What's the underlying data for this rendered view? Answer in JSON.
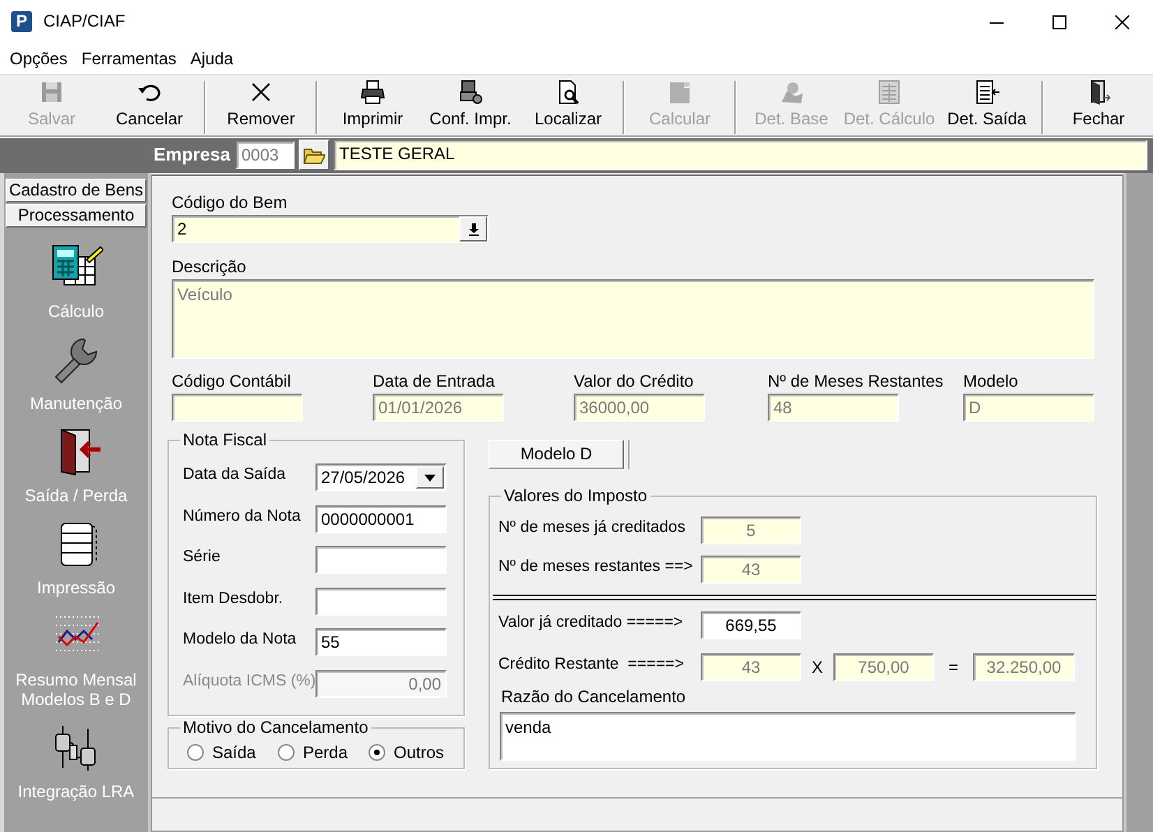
{
  "window": {
    "logo": "P",
    "title": "CIAP/CIAF"
  },
  "menu": [
    "Opções",
    "Ferramentas",
    "Ajuda"
  ],
  "toolbar_groups": [
    [
      {
        "label": "Salvar",
        "disabled": true
      },
      {
        "label": "Cancelar",
        "disabled": false
      }
    ],
    [
      {
        "label": "Remover",
        "disabled": false
      }
    ],
    [
      {
        "label": "Imprimir",
        "disabled": false
      },
      {
        "label": "Conf. Impr.",
        "disabled": false
      },
      {
        "label": "Localizar",
        "disabled": false
      }
    ],
    [
      {
        "label": "Calcular",
        "disabled": true
      }
    ],
    [
      {
        "label": "Det. Base",
        "disabled": true
      },
      {
        "label": "Det. Cálculo",
        "disabled": true
      },
      {
        "label": "Det. Saída",
        "disabled": false
      }
    ],
    [
      {
        "label": "Fechar",
        "disabled": false
      }
    ]
  ],
  "empresa": {
    "label": "Empresa",
    "code": "0003",
    "name": "TESTE GERAL"
  },
  "sidebar": {
    "headers": [
      "Cadastro de Bens",
      "Processamento"
    ],
    "items": [
      "Cálculo",
      "Manutenção",
      "Saída / Perda",
      "Impressão",
      "Resumo Mensal\nModelos B e D",
      "Integração LRA"
    ]
  },
  "form": {
    "codigo_bem": {
      "label": "Código do Bem",
      "value": "2",
      "disabled": false
    },
    "descricao": {
      "label": "Descrição",
      "value": "Veículo",
      "disabled": true
    },
    "info_fields": [
      {
        "label": "Código Contábil"
      },
      {
        "label": "Data de Entrada",
        "value": "01/01/2026",
        "disabled": true
      },
      {
        "label": "Valor do Crédito",
        "value": "36000,00",
        "disabled": true
      },
      {
        "label": "Nº de Meses Restantes",
        "value": "48",
        "disabled": true
      },
      {
        "label": "Modelo",
        "value": "D",
        "disabled": true
      }
    ],
    "nota_fiscal": {
      "title": "Nota Fiscal",
      "fields": [
        {
          "kind": "date",
          "label": "Data da Saída",
          "value": "27/05/2026",
          "disabled": false
        },
        {
          "kind": "text",
          "label": "Número da Nota",
          "value": "0000000001",
          "disabled": false
        },
        {
          "kind": "text",
          "label": "Série"
        },
        {
          "kind": "text",
          "label": "Item Desdobr."
        },
        {
          "kind": "text",
          "label": "Modelo da Nota",
          "value": "55",
          "disabled": false
        },
        {
          "kind": "number",
          "label": "Alíquota ICMS (%)",
          "value": "0,00",
          "disabled": true
        }
      ]
    },
    "motivo": {
      "title": "Motivo do Cancelamento",
      "options": [
        {
          "label": "Saída",
          "selected": false
        },
        {
          "label": "Perda",
          "selected": false
        },
        {
          "label": "Outros",
          "selected": true
        }
      ]
    },
    "tab": {
      "label": "Modelo D"
    },
    "valores": {
      "title": "Valores do Imposto",
      "rows": [
        {
          "label": "Nº de meses já creditados",
          "value": "5",
          "disabled": true
        },
        {
          "label": "Nº de meses restantes ==>",
          "value": "43",
          "disabled": true
        }
      ],
      "rows_after_rule": [
        {
          "label": "Valor já creditado =====>",
          "value": "669,55",
          "disabled": false
        }
      ],
      "credito_restante": {
        "label": "Crédito Restante  =====>",
        "months": "43",
        "times": "X",
        "rate": "750,00",
        "equals": "=",
        "total": "32.250,00",
        "disabled": true
      },
      "razao": {
        "label": "Razão do Cancelamento",
        "value": "venda",
        "disabled": false
      }
    }
  }
}
